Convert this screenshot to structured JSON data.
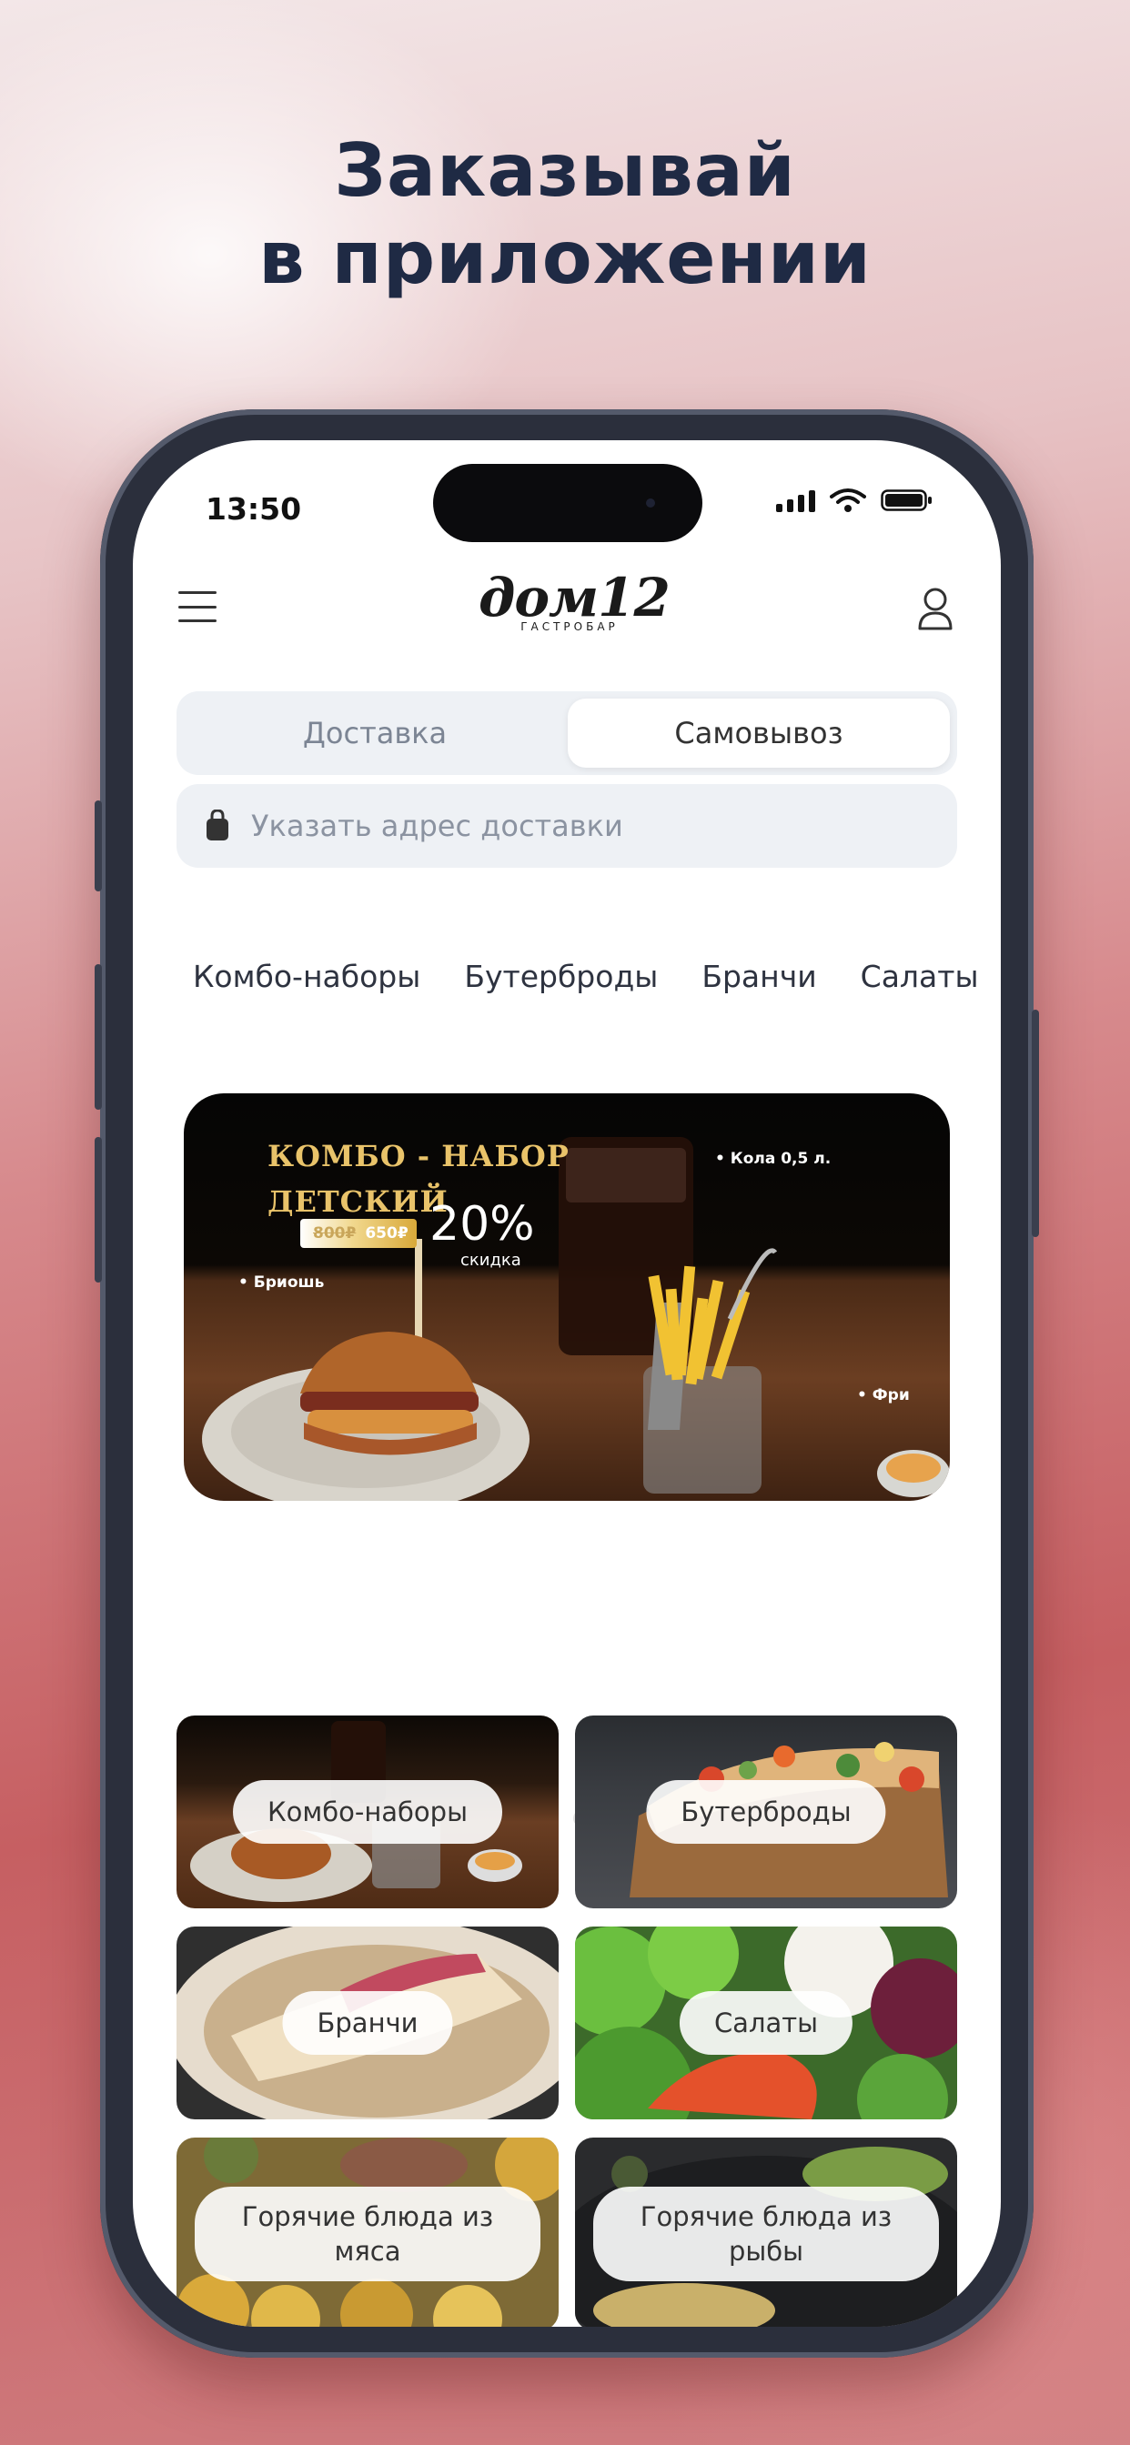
{
  "headline": {
    "line1": "Заказывай",
    "line2": "в приложении"
  },
  "status": {
    "time": "13:50"
  },
  "logo": {
    "script": "дом12",
    "subtitle": "ГАСТРОБАР"
  },
  "mode": {
    "delivery": "Доставка",
    "pickup": "Самовывоз",
    "selected": "pickup"
  },
  "address": {
    "placeholder": "Указать адрес доставки"
  },
  "categories": [
    "Комбо-наборы",
    "Бутерброды",
    "Бранчи",
    "Салаты"
  ],
  "banner": {
    "title_line1": "КОМБО - НАБОР",
    "title_line2": "ДЕТСКИЙ",
    "old_price": "800₽",
    "new_price": "650₽",
    "discount": "20%",
    "discount_label": "скидка",
    "items": {
      "drink": "Кола 0,5 л.",
      "bun": "Бриошь",
      "fries": "Фри"
    }
  },
  "carousel": {
    "page": 1,
    "total": 3
  },
  "tiles": [
    {
      "label": "Комбо-наборы"
    },
    {
      "label": "Бутерброды"
    },
    {
      "label": "Бранчи"
    },
    {
      "label": "Салаты"
    },
    {
      "label": "Горячие блюда из мяса"
    },
    {
      "label": "Горячие блюда из рыбы"
    }
  ]
}
